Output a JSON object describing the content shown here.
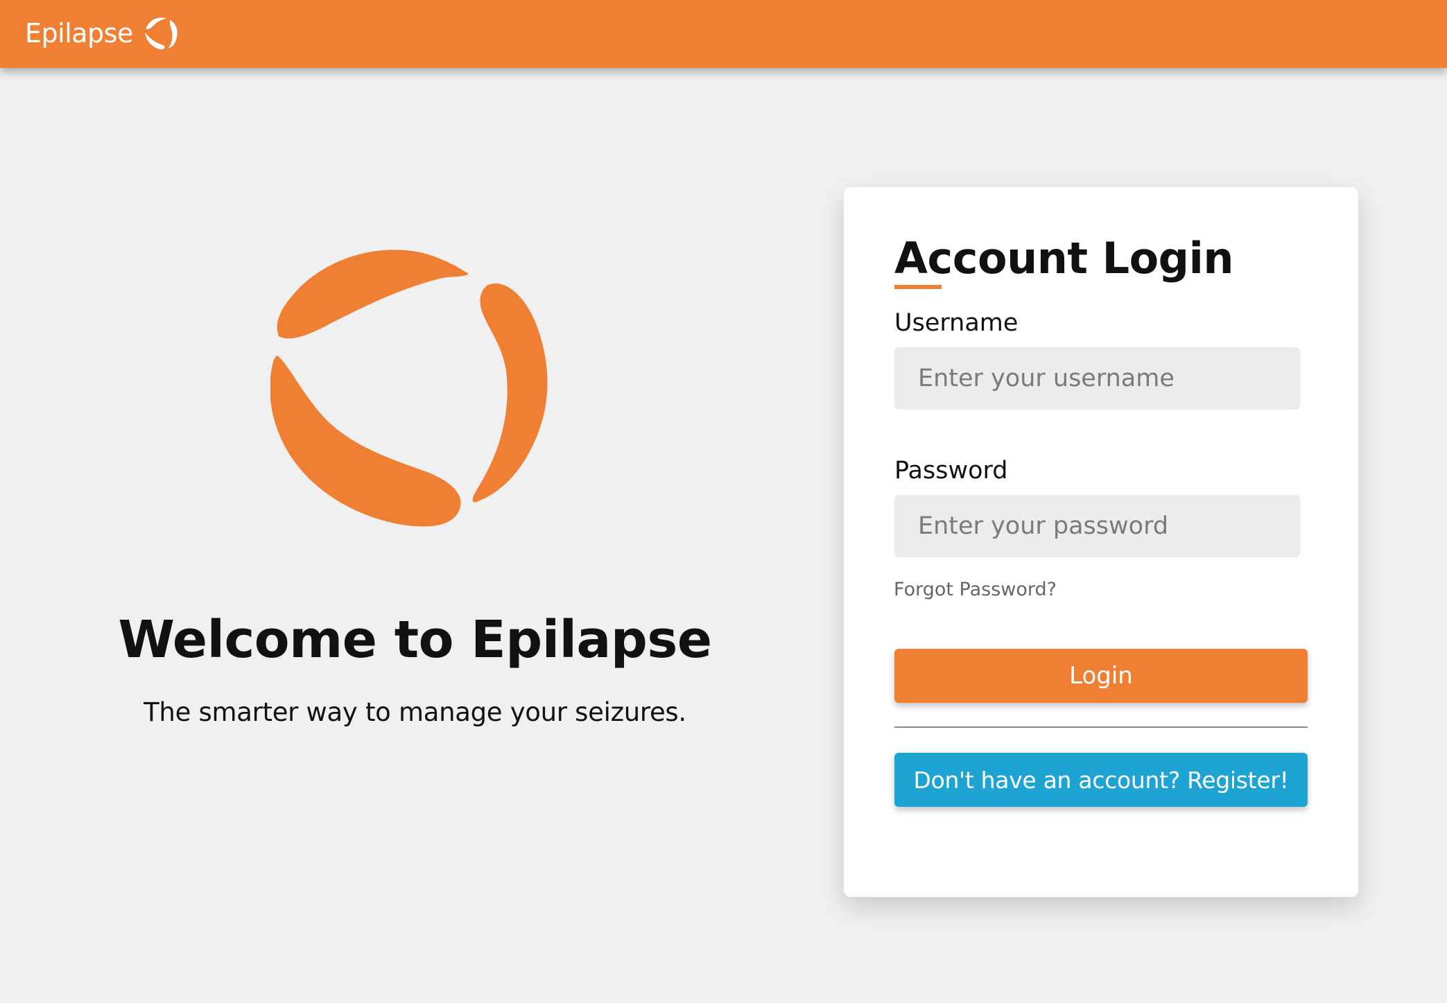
{
  "colors": {
    "brand_orange": "#ee7f33",
    "register_blue": "#1ea4d2",
    "page_background": "#f0f0f0",
    "card_background": "#ffffff",
    "input_background": "#ececec"
  },
  "header": {
    "brand_name": "Epilapse",
    "logo_icon": "epilapse-logo-icon"
  },
  "hero": {
    "logo_icon": "epilapse-logo-icon",
    "title": "Welcome to Epilapse",
    "subtitle": "The smarter way to manage your seizures."
  },
  "login": {
    "title": "Account Login",
    "username": {
      "label": "Username",
      "placeholder": "Enter your username",
      "value": ""
    },
    "password": {
      "label": "Password",
      "placeholder": "Enter your password",
      "value": ""
    },
    "forgot_label": "Forgot Password?",
    "login_label": "Login",
    "register_label": "Don't have an account? Register!"
  }
}
